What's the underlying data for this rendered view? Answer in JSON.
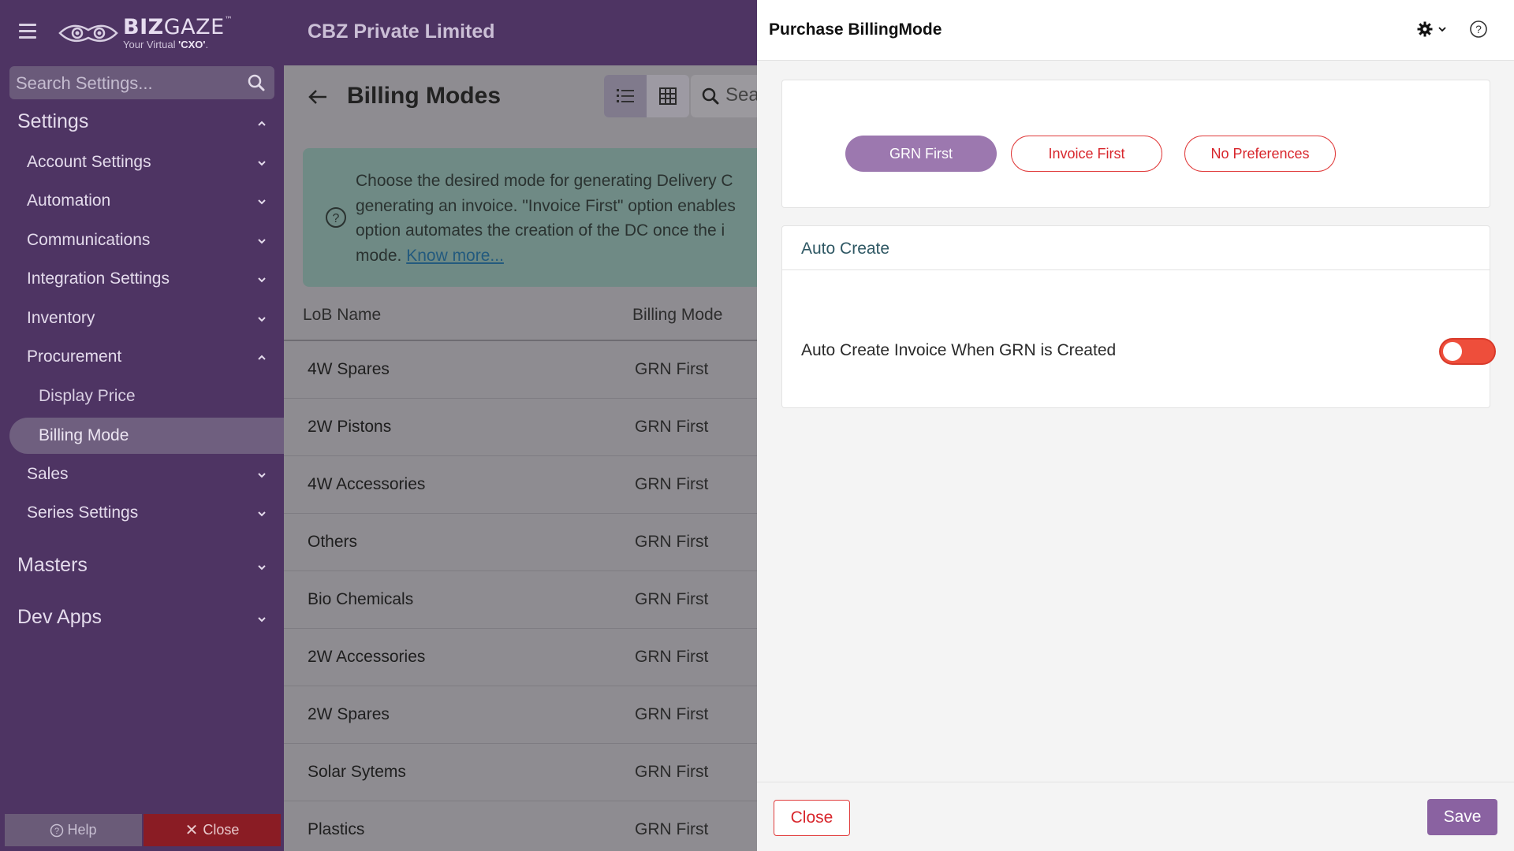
{
  "app": {
    "logo_name_bold": "BIZ",
    "logo_name_rest": "GAZE",
    "logo_tm": "™",
    "logo_tag_prefix": "Your Virtual ",
    "logo_tag_bold": "'CXO'",
    "logo_tag_suffix": ".",
    "company": "CBZ Private Limited"
  },
  "sidebar": {
    "search_placeholder": "Search Settings...",
    "sections": [
      {
        "label": "Settings"
      },
      {
        "label": "Masters"
      },
      {
        "label": "Dev Apps"
      }
    ],
    "items": [
      {
        "label": "Account Settings"
      },
      {
        "label": "Automation"
      },
      {
        "label": "Communications"
      },
      {
        "label": "Integration Settings"
      },
      {
        "label": "Inventory"
      },
      {
        "label": "Procurement"
      },
      {
        "label": "Sales"
      },
      {
        "label": "Series Settings"
      }
    ],
    "subitems": [
      {
        "label": "Display Price"
      },
      {
        "label": "Billing Mode",
        "active": true
      }
    ],
    "help_label": "Help",
    "close_label": "Close"
  },
  "main": {
    "title": "Billing Modes",
    "search_placeholder": "Sea",
    "info_lines": [
      "Choose the desired mode for generating Delivery C",
      "generating an invoice. \"Invoice First\" option enables",
      "option automates the creation of the DC once the i",
      "mode. "
    ],
    "info_link": "Know more...",
    "columns": [
      "LoB Name",
      "Billing Mode"
    ],
    "rows": [
      {
        "name": "4W Spares",
        "mode": "GRN First"
      },
      {
        "name": "2W Pistons",
        "mode": "GRN First"
      },
      {
        "name": "4W Accessories",
        "mode": "GRN First"
      },
      {
        "name": "Others",
        "mode": "GRN First"
      },
      {
        "name": "Bio Chemicals",
        "mode": "GRN First"
      },
      {
        "name": "2W Accessories",
        "mode": "GRN First"
      },
      {
        "name": "2W Spares",
        "mode": "GRN First"
      },
      {
        "name": "Solar Sytems",
        "mode": "GRN First"
      },
      {
        "name": "Plastics",
        "mode": "GRN First"
      }
    ]
  },
  "panel": {
    "title": "Purchase BillingMode",
    "options": [
      {
        "label": "GRN First",
        "selected": true
      },
      {
        "label": "Invoice First",
        "selected": false
      },
      {
        "label": "No Preferences",
        "selected": false
      }
    ],
    "auto_create_header": "Auto Create",
    "auto_create_label": "Auto Create Invoice When GRN is Created",
    "auto_create_on": false,
    "close_label": "Close",
    "save_label": "Save"
  },
  "colors": {
    "sidebar_bg": "#4e3463",
    "accent": "#8a62a1",
    "danger": "#d8262c",
    "toggle_off": "#ee4e3b"
  }
}
